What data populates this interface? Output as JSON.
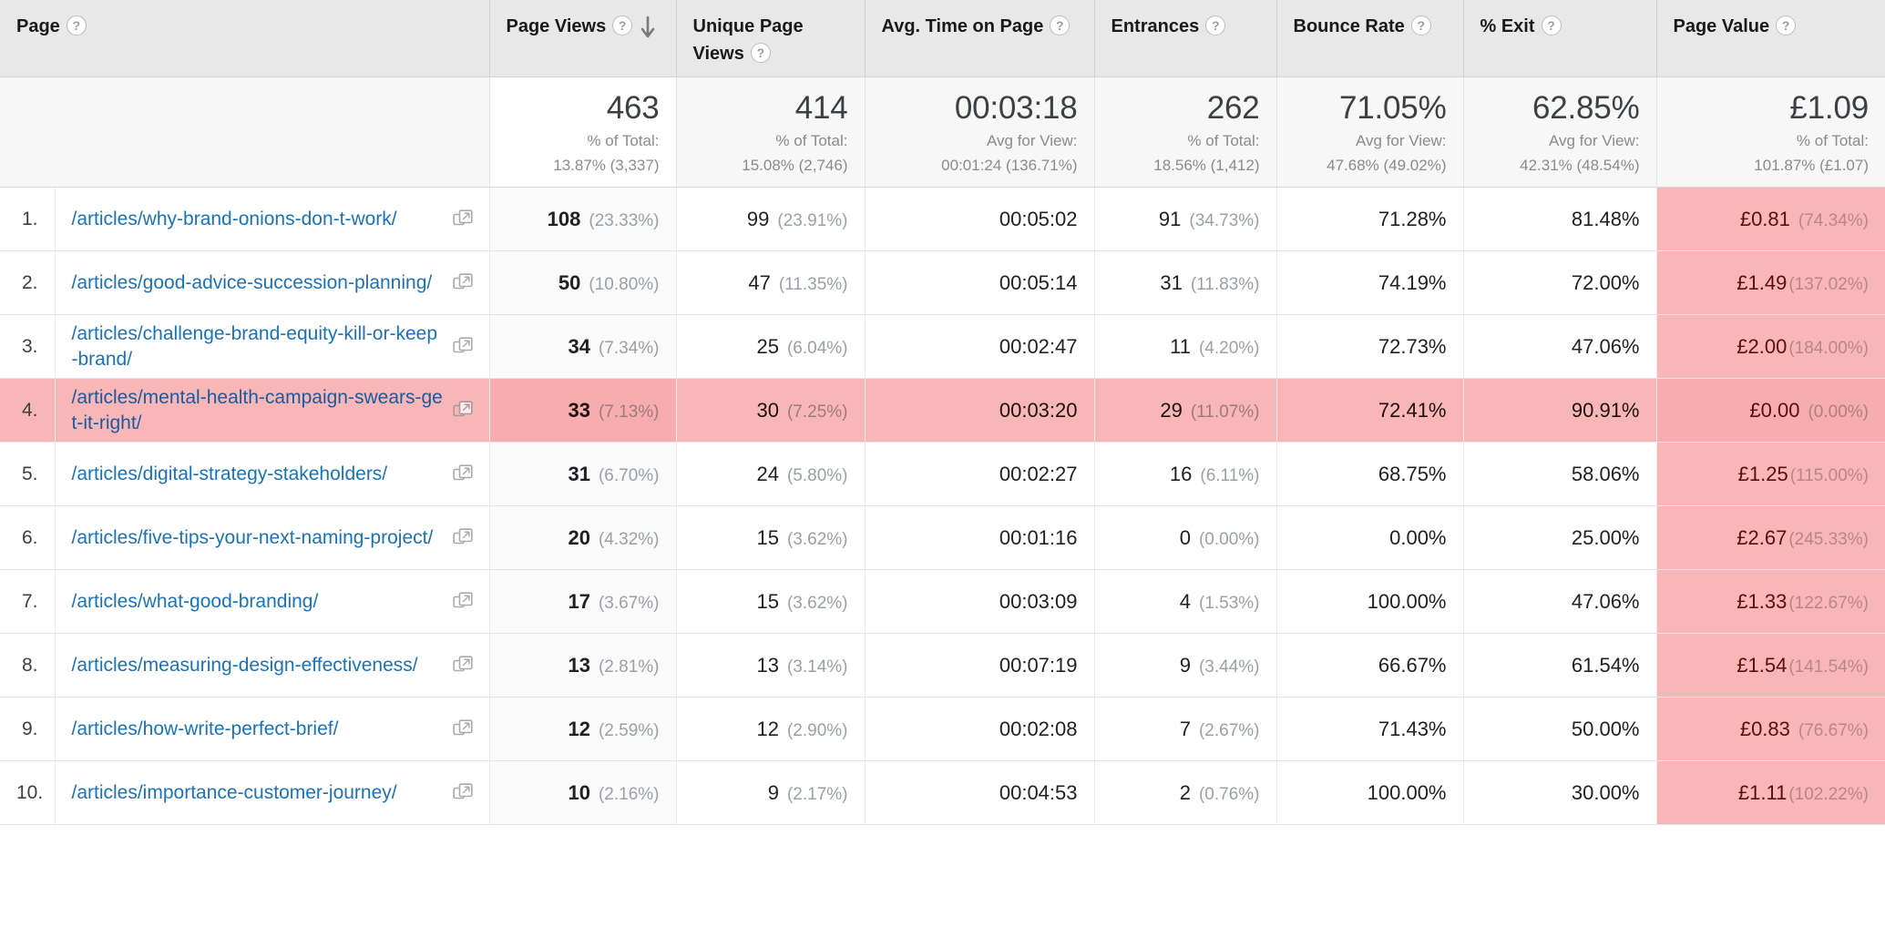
{
  "table": {
    "columns": [
      {
        "key": "index",
        "label": "",
        "has_help": false,
        "sorted": false
      },
      {
        "key": "page",
        "label": "Page",
        "has_help": true,
        "sorted": false
      },
      {
        "key": "pageviews",
        "label": "Page Views",
        "has_help": true,
        "sorted": true,
        "sort_direction": "descending",
        "sort_icon": "arrow-down-icon"
      },
      {
        "key": "uniquepv",
        "label": "Unique Page Views",
        "has_help": true,
        "sorted": false
      },
      {
        "key": "avgtime",
        "label": "Avg. Time on Page",
        "has_help": true,
        "sorted": false
      },
      {
        "key": "entrances",
        "label": "Entrances",
        "has_help": true,
        "sorted": false
      },
      {
        "key": "bounce",
        "label": "Bounce Rate",
        "has_help": true,
        "sorted": false
      },
      {
        "key": "exit",
        "label": "% Exit",
        "has_help": true,
        "sorted": false
      },
      {
        "key": "pagevalue",
        "label": "Page Value",
        "has_help": true,
        "sorted": false
      }
    ],
    "help_glyph": "?",
    "summary": {
      "pageviews": {
        "value": "463",
        "label": "% of Total:",
        "detail": "13.87% (3,337)"
      },
      "uniquepv": {
        "value": "414",
        "label": "% of Total:",
        "detail": "15.08% (2,746)"
      },
      "avgtime": {
        "value": "00:03:18",
        "label": "Avg for View:",
        "detail": "00:01:24 (136.71%)"
      },
      "entrances": {
        "value": "262",
        "label": "% of Total:",
        "detail": "18.56% (1,412)"
      },
      "bounce": {
        "value": "71.05%",
        "label": "Avg for View:",
        "detail": "47.68% (49.02%)"
      },
      "exit": {
        "value": "62.85%",
        "label": "Avg for View:",
        "detail": "42.31% (48.54%)"
      },
      "pagevalue": {
        "value": "£1.09",
        "label": "% of Total:",
        "detail": "101.87% (£1.07)"
      }
    },
    "external_link_icon": "external-link-icon",
    "rows": [
      {
        "index": "1.",
        "page": "/articles/why-brand-onions-don-t-work/",
        "highlighted": false,
        "pageviews": "108",
        "pageviews_pct": "(23.33%)",
        "uniquepv": "99",
        "uniquepv_pct": "(23.91%)",
        "avgtime": "00:05:02",
        "entrances": "91",
        "entrances_pct": "(34.73%)",
        "bounce": "71.28%",
        "exit": "81.48%",
        "pagevalue": "£0.81",
        "pagevalue_pct": "(74.34%)"
      },
      {
        "index": "2.",
        "page": "/articles/good-advice-succession-planning/",
        "highlighted": false,
        "pageviews": "50",
        "pageviews_pct": "(10.80%)",
        "uniquepv": "47",
        "uniquepv_pct": "(11.35%)",
        "avgtime": "00:05:14",
        "entrances": "31",
        "entrances_pct": "(11.83%)",
        "bounce": "74.19%",
        "exit": "72.00%",
        "pagevalue": "£1.49",
        "pagevalue_pct": "(137.02%)"
      },
      {
        "index": "3.",
        "page": "/articles/challenge-brand-equity-kill-or-keep-brand/",
        "highlighted": false,
        "pageviews": "34",
        "pageviews_pct": "(7.34%)",
        "uniquepv": "25",
        "uniquepv_pct": "(6.04%)",
        "avgtime": "00:02:47",
        "entrances": "11",
        "entrances_pct": "(4.20%)",
        "bounce": "72.73%",
        "exit": "47.06%",
        "pagevalue": "£2.00",
        "pagevalue_pct": "(184.00%)"
      },
      {
        "index": "4.",
        "page": "/articles/mental-health-campaign-swears-get-it-right/",
        "highlighted": true,
        "pageviews": "33",
        "pageviews_pct": "(7.13%)",
        "uniquepv": "30",
        "uniquepv_pct": "(7.25%)",
        "avgtime": "00:03:20",
        "entrances": "29",
        "entrances_pct": "(11.07%)",
        "bounce": "72.41%",
        "exit": "90.91%",
        "pagevalue": "£0.00",
        "pagevalue_pct": "(0.00%)"
      },
      {
        "index": "5.",
        "page": "/articles/digital-strategy-stakeholders/",
        "highlighted": false,
        "pageviews": "31",
        "pageviews_pct": "(6.70%)",
        "uniquepv": "24",
        "uniquepv_pct": "(5.80%)",
        "avgtime": "00:02:27",
        "entrances": "16",
        "entrances_pct": "(6.11%)",
        "bounce": "68.75%",
        "exit": "58.06%",
        "pagevalue": "£1.25",
        "pagevalue_pct": "(115.00%)"
      },
      {
        "index": "6.",
        "page": "/articles/five-tips-your-next-naming-project/",
        "highlighted": false,
        "pageviews": "20",
        "pageviews_pct": "(4.32%)",
        "uniquepv": "15",
        "uniquepv_pct": "(3.62%)",
        "avgtime": "00:01:16",
        "entrances": "0",
        "entrances_pct": "(0.00%)",
        "bounce": "0.00%",
        "exit": "25.00%",
        "pagevalue": "£2.67",
        "pagevalue_pct": "(245.33%)"
      },
      {
        "index": "7.",
        "page": "/articles/what-good-branding/",
        "highlighted": false,
        "pageviews": "17",
        "pageviews_pct": "(3.67%)",
        "uniquepv": "15",
        "uniquepv_pct": "(3.62%)",
        "avgtime": "00:03:09",
        "entrances": "4",
        "entrances_pct": "(1.53%)",
        "bounce": "100.00%",
        "exit": "47.06%",
        "pagevalue": "£1.33",
        "pagevalue_pct": "(122.67%)"
      },
      {
        "index": "8.",
        "page": "/articles/measuring-design-effectiveness/",
        "highlighted": false,
        "pageviews": "13",
        "pageviews_pct": "(2.81%)",
        "uniquepv": "13",
        "uniquepv_pct": "(3.14%)",
        "avgtime": "00:07:19",
        "entrances": "9",
        "entrances_pct": "(3.44%)",
        "bounce": "66.67%",
        "exit": "61.54%",
        "pagevalue": "£1.54",
        "pagevalue_pct": "(141.54%)"
      },
      {
        "index": "9.",
        "page": "/articles/how-write-perfect-brief/",
        "highlighted": false,
        "pageviews": "12",
        "pageviews_pct": "(2.59%)",
        "uniquepv": "12",
        "uniquepv_pct": "(2.90%)",
        "avgtime": "00:02:08",
        "entrances": "7",
        "entrances_pct": "(2.67%)",
        "bounce": "71.43%",
        "exit": "50.00%",
        "pagevalue": "£0.83",
        "pagevalue_pct": "(76.67%)"
      },
      {
        "index": "10.",
        "page": "/articles/importance-customer-journey/",
        "highlighted": false,
        "pageviews": "10",
        "pageviews_pct": "(2.16%)",
        "uniquepv": "9",
        "uniquepv_pct": "(2.17%)",
        "avgtime": "00:04:53",
        "entrances": "2",
        "entrances_pct": "(0.76%)",
        "bounce": "100.00%",
        "exit": "30.00%",
        "pagevalue": "£1.11",
        "pagevalue_pct": "(102.22%)"
      }
    ]
  },
  "colors": {
    "link": "#1a73b7",
    "header_bg": "#e8e8e8",
    "summary_bg": "#f7f7f7",
    "highlight_row": "#f9b6b6",
    "page_value_cell": "#f9b6b6",
    "page_value_text": "#5c0d0d",
    "muted_text": "#9aa0a6"
  }
}
